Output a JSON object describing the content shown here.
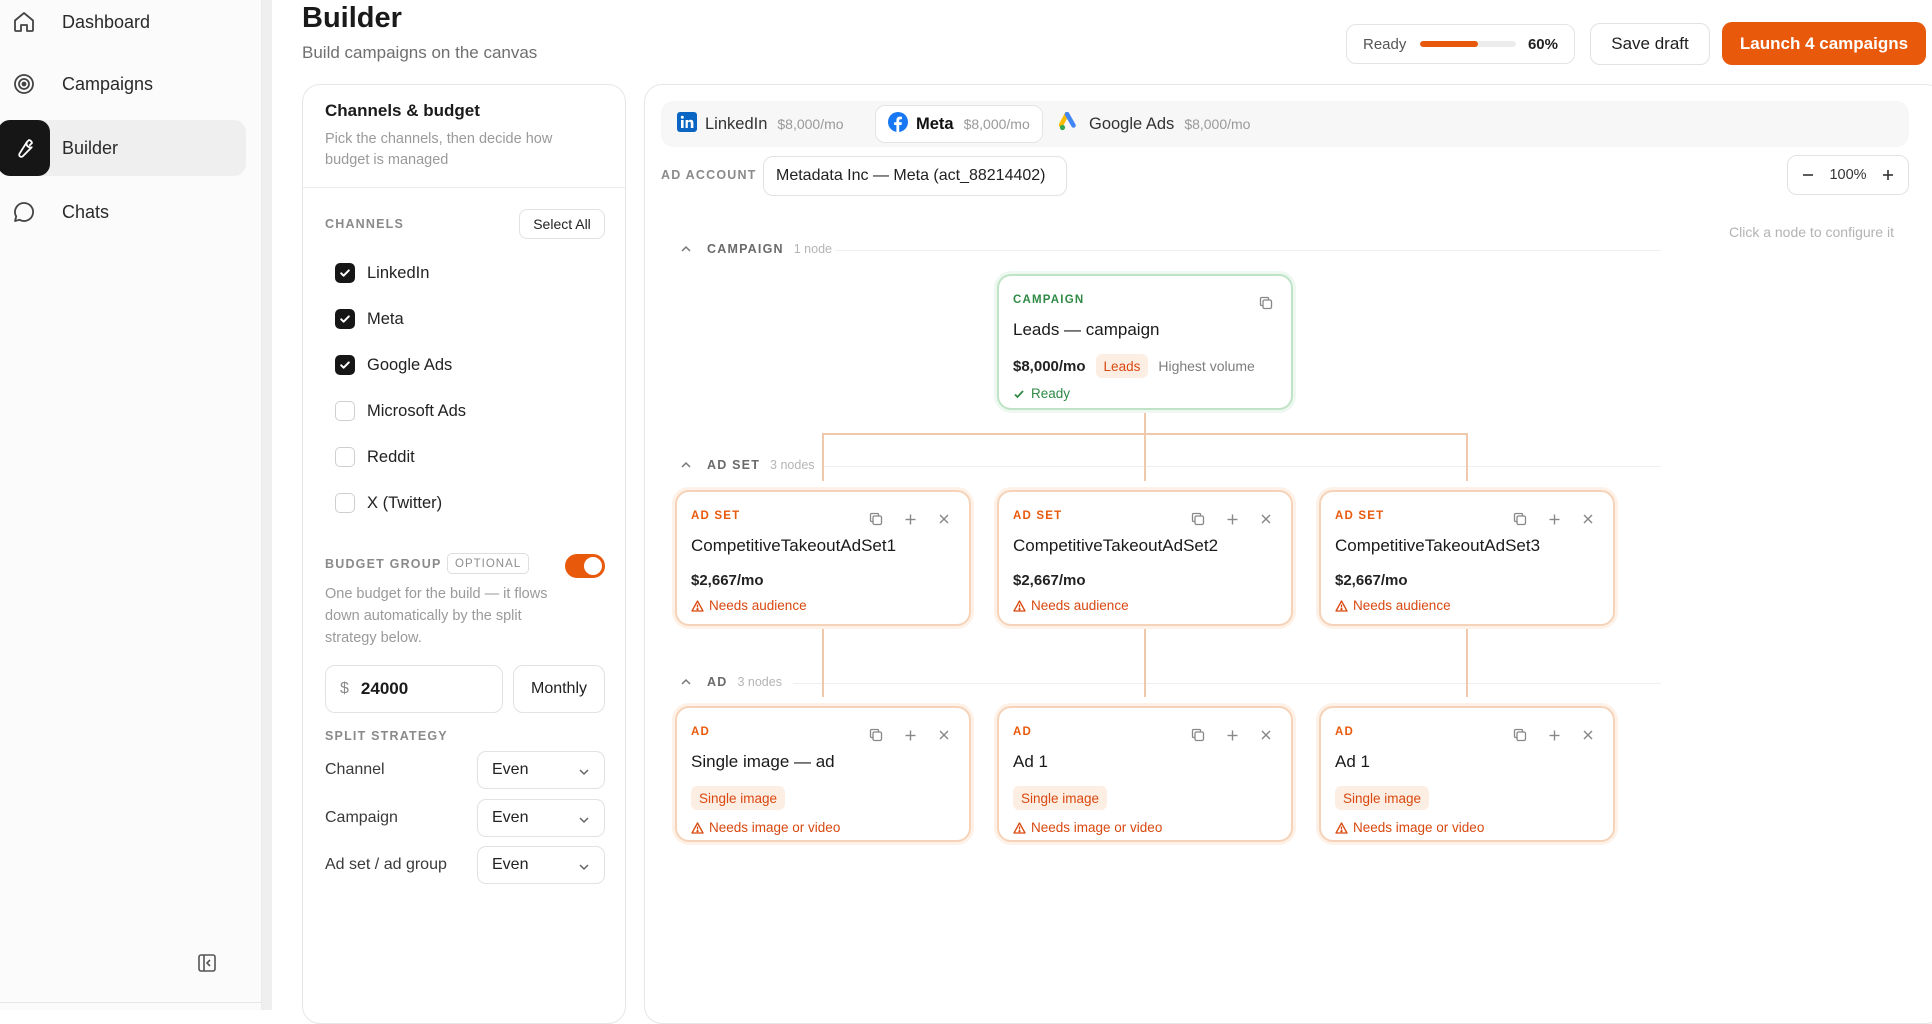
{
  "sidebar": {
    "items": [
      {
        "label": "Dashboard",
        "icon": "home-icon"
      },
      {
        "label": "Campaigns",
        "icon": "target-icon"
      },
      {
        "label": "Builder",
        "icon": "wrench-icon",
        "active": true
      },
      {
        "label": "Chats",
        "icon": "chat-bubble-icon"
      }
    ],
    "collapse_icon": "sidebar-collapse-icon"
  },
  "header": {
    "title": "Builder",
    "subtitle": "Build campaigns on the canvas",
    "progress_label": "Ready",
    "progress_value": 0.6,
    "progress_text": "60%",
    "save_label": "Save draft",
    "launch_label": "Launch 4 campaigns"
  },
  "panel": {
    "title": "Channels & budget",
    "description": "Pick the channels, then decide how budget is managed",
    "channels_label": "CHANNELS",
    "select_all_label": "Select All",
    "channels": [
      {
        "label": "LinkedIn",
        "checked": true
      },
      {
        "label": "Meta",
        "checked": true
      },
      {
        "label": "Google Ads",
        "checked": true
      },
      {
        "label": "Microsoft Ads",
        "checked": false
      },
      {
        "label": "Reddit",
        "checked": false
      },
      {
        "label": "X (Twitter)",
        "checked": false
      }
    ],
    "budget_group_label": "BUDGET GROUP",
    "optional_label": "OPTIONAL",
    "budget_group_enabled": true,
    "budget_description": "One budget for the build — it flows down automatically by the split strategy below.",
    "currency_symbol": "$",
    "amount": "24000",
    "period": "Monthly",
    "split_label": "SPLIT STRATEGY",
    "split_rows": [
      {
        "label": "Channel",
        "value": "Even"
      },
      {
        "label": "Campaign",
        "value": "Even"
      },
      {
        "label": "Ad set / ad group",
        "value": "Even"
      }
    ]
  },
  "canvas": {
    "tabs": [
      {
        "name": "LinkedIn",
        "budget": "$8,000/mo",
        "icon": "linkedin-icon"
      },
      {
        "name": "Meta",
        "budget": "$8,000/mo",
        "icon": "meta-icon",
        "active": true
      },
      {
        "name": "Google Ads",
        "budget": "$8,000/mo",
        "icon": "google-ads-icon"
      }
    ],
    "ad_account_label": "AD ACCOUNT",
    "ad_account_value": "Metadata Inc — Meta (act_88214402)",
    "zoom": "100%",
    "hint": "Click a node to configure it",
    "levels": {
      "campaign": {
        "title": "CAMPAIGN",
        "count": "1 node"
      },
      "adset": {
        "title": "AD SET",
        "count": "3 nodes"
      },
      "ad": {
        "title": "AD",
        "count": "3 nodes"
      }
    },
    "campaign_node": {
      "type": "CAMPAIGN",
      "name": "Leads — campaign",
      "budget": "$8,000/mo",
      "objective": "Leads",
      "strategy": "Highest volume",
      "status": "Ready"
    },
    "adset_nodes": [
      {
        "type": "AD SET",
        "name": "CompetitiveTakeoutAdSet1",
        "budget": "$2,667/mo",
        "warning": "Needs audience"
      },
      {
        "type": "AD SET",
        "name": "CompetitiveTakeoutAdSet2",
        "budget": "$2,667/mo",
        "warning": "Needs audience"
      },
      {
        "type": "AD SET",
        "name": "CompetitiveTakeoutAdSet3",
        "budget": "$2,667/mo",
        "warning": "Needs audience"
      }
    ],
    "ad_nodes": [
      {
        "type": "AD",
        "name": "Single image — ad",
        "format": "Single image",
        "warning": "Needs image or video"
      },
      {
        "type": "AD",
        "name": "Ad 1",
        "format": "Single image",
        "warning": "Needs image or video"
      },
      {
        "type": "AD",
        "name": "Ad 1",
        "format": "Single image",
        "warning": "Needs image or video"
      }
    ]
  },
  "colors": {
    "accent": "#e8590c",
    "success": "#2f8a45",
    "dark": "#161616"
  }
}
